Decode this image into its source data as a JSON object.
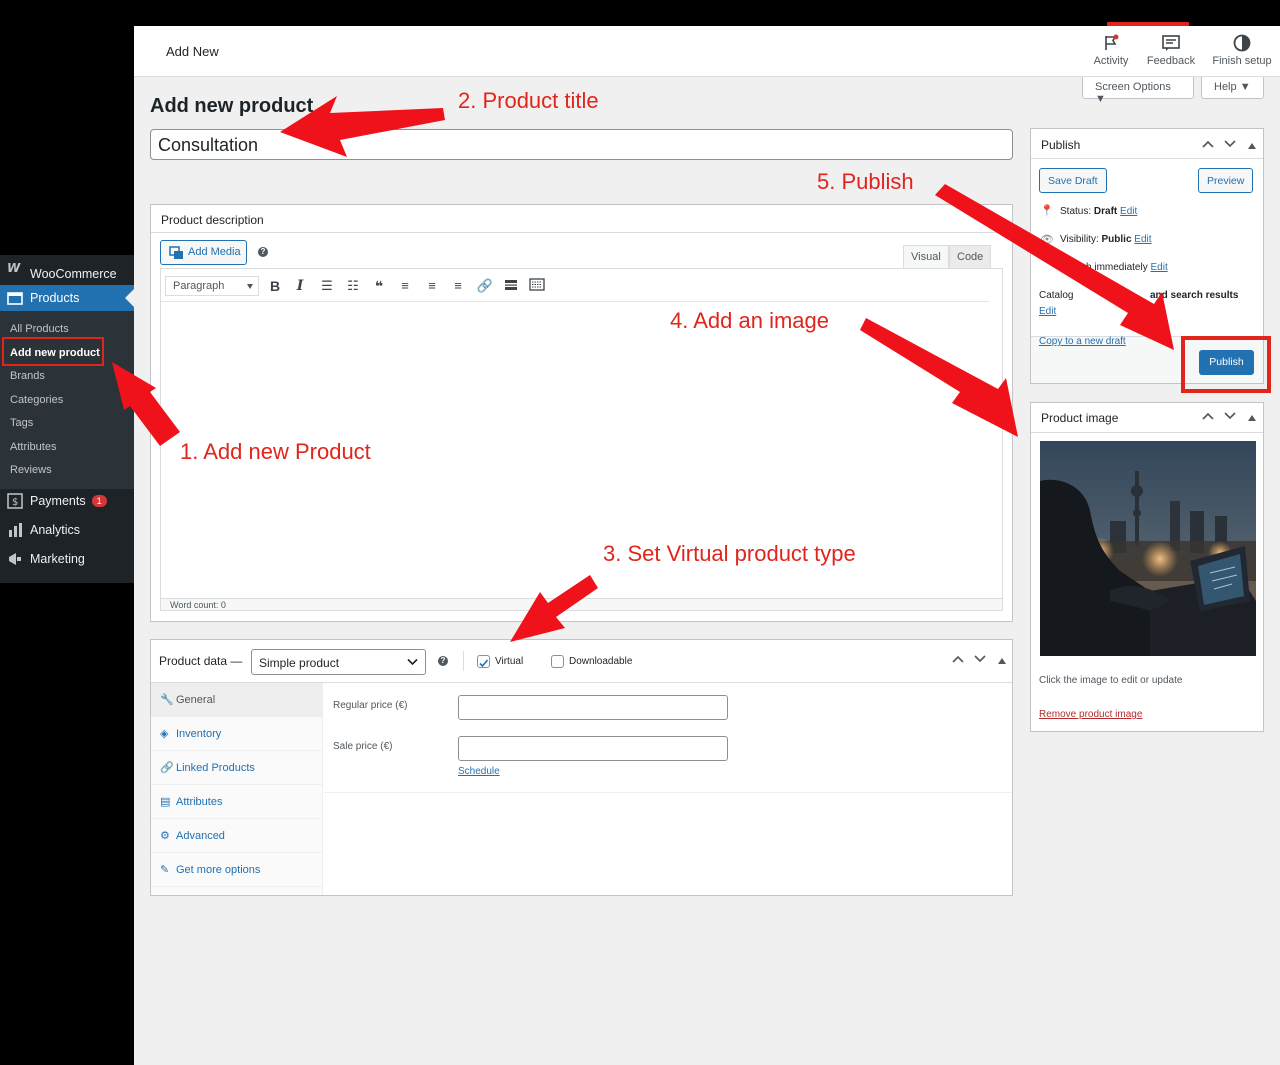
{
  "sidebar": {
    "woocommerce": "WooCommerce",
    "products": "Products",
    "submenu": [
      "All Products",
      "Add new product",
      "Brands",
      "Categories",
      "Tags",
      "Attributes",
      "Reviews"
    ],
    "payments": "Payments",
    "payments_badge": "1",
    "analytics": "Analytics",
    "marketing": "Marketing"
  },
  "topbar": {
    "page": "Add New",
    "activity": "Activity",
    "feedback": "Feedback",
    "finish_setup": "Finish setup",
    "screen_options": "Screen Options",
    "help": "Help"
  },
  "page_title": "Add new product",
  "product_title_value": "Consultation",
  "description": {
    "title": "Product description",
    "add_media": "Add Media",
    "tab_visual": "Visual",
    "tab_code": "Code",
    "format": "Paragraph",
    "word_count": "Word count: 0"
  },
  "product_data": {
    "title": "Product data —",
    "type": "Simple product",
    "virtual": "Virtual",
    "virtual_checked": true,
    "downloadable": "Downloadable",
    "tabs": [
      "General",
      "Inventory",
      "Linked Products",
      "Attributes",
      "Advanced",
      "Get more options"
    ],
    "regular_price_label": "Regular price (€)",
    "sale_price_label": "Sale price (€)",
    "schedule": "Schedule"
  },
  "publish": {
    "title": "Publish",
    "save_draft": "Save Draft",
    "preview": "Preview",
    "status_label": "Status:",
    "status_value": "Draft",
    "visibility_label": "Visibility:",
    "visibility_value": "Public",
    "publish_when": "blish immediately",
    "catalog_prefix": "Catalog",
    "catalog_suffix": "and search results",
    "edit": "Edit",
    "copy_draft": "Copy to a new draft",
    "publish_button": "Publish"
  },
  "product_image": {
    "title": "Product image",
    "hint": "Click the image to edit or update",
    "remove": "Remove product image"
  },
  "annotations": {
    "step1": "1. Add new Product",
    "step2": "2. Product title",
    "step3": "3. Set Virtual product type",
    "step4": "4. Add an image",
    "step5": "5. Publish"
  },
  "colors": {
    "wp_blue": "#2271b1",
    "annotation_red": "#e0251c",
    "sidebar_dark": "#1d2327"
  }
}
